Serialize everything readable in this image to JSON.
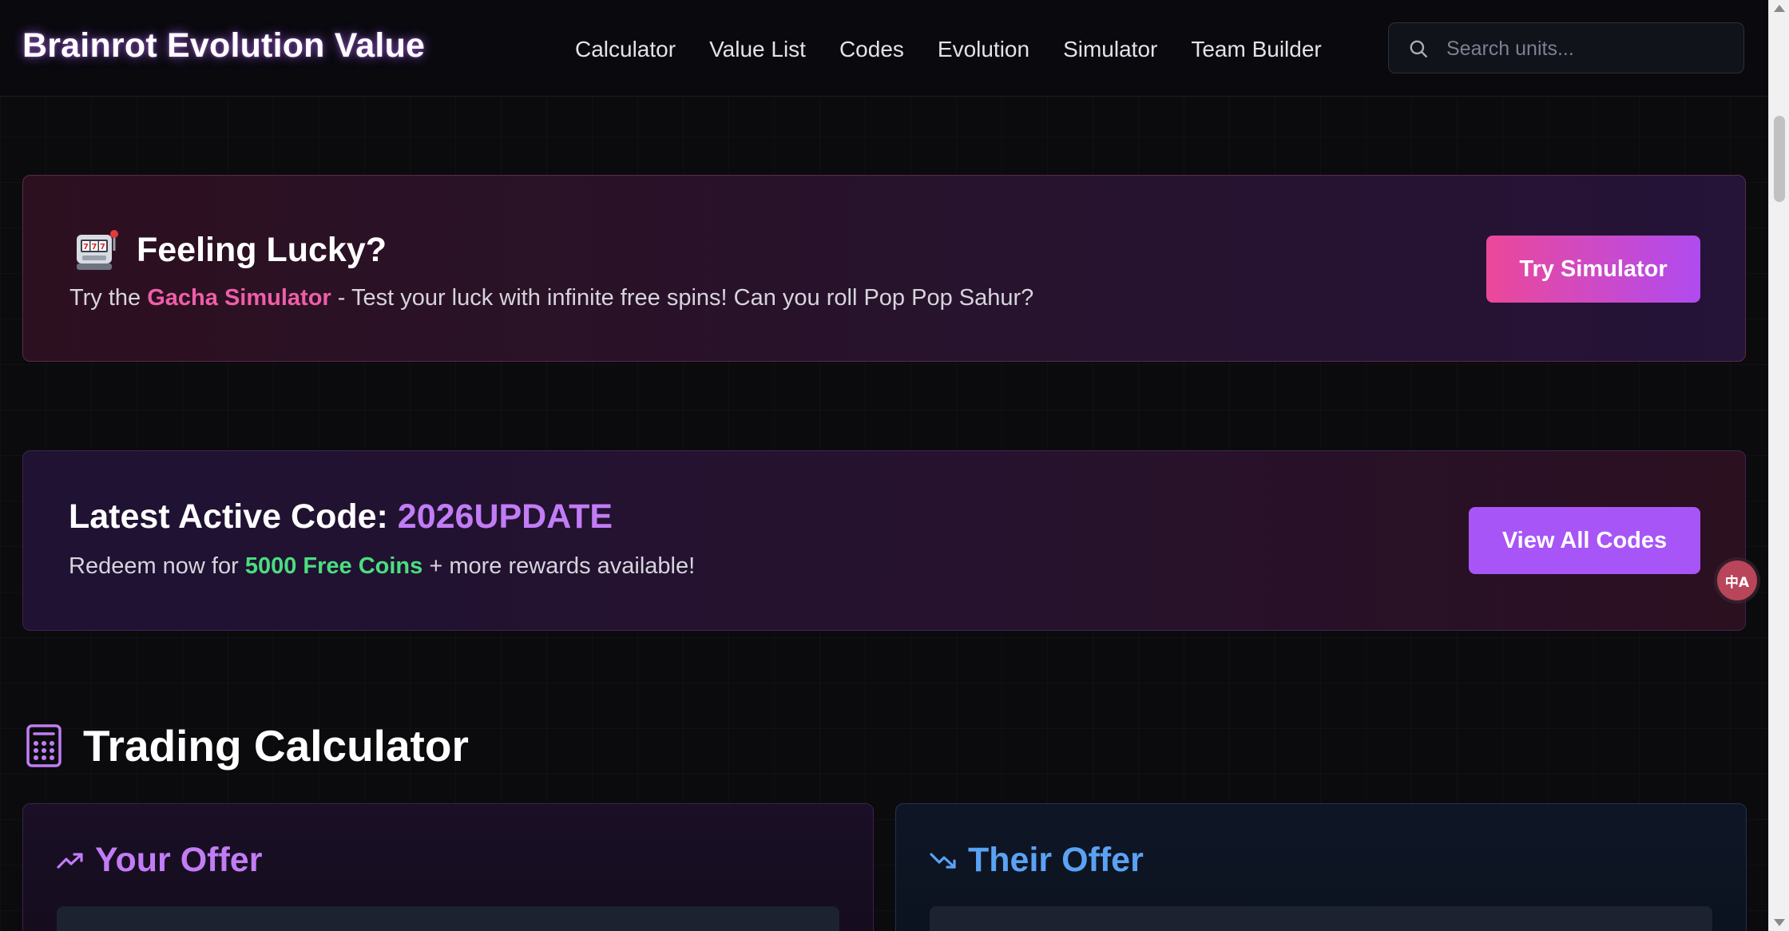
{
  "header": {
    "brand": "Brainrot Evolution Value",
    "nav": [
      {
        "label": "Calculator"
      },
      {
        "label": "Value List"
      },
      {
        "label": "Codes"
      },
      {
        "label": "Evolution"
      },
      {
        "label": "Simulator"
      },
      {
        "label": "Team Builder"
      }
    ],
    "search": {
      "placeholder": "Search units..."
    }
  },
  "lucky_card": {
    "title": "Feeling Lucky?",
    "desc_prefix": "Try the ",
    "desc_highlight": "Gacha Simulator",
    "desc_suffix": " - Test your luck with infinite free spins! Can you roll Pop Pop Sahur?",
    "button": "Try Simulator",
    "icon": "slot-machine-icon"
  },
  "code_card": {
    "title_prefix": "Latest Active Code: ",
    "code": "2026UPDATE",
    "desc_prefix": "Redeem now for ",
    "desc_highlight": "5000 Free Coins",
    "desc_suffix": " + more rewards available!",
    "button": "View All Codes"
  },
  "translate_badge": {
    "label": "中A"
  },
  "calculator": {
    "title": "Trading Calculator",
    "your_offer": {
      "title": "Your Offer",
      "icon": "trending-up-icon"
    },
    "their_offer": {
      "title": "Their Offer",
      "icon": "trending-down-icon"
    }
  },
  "colors": {
    "accent_purple": "#a855f7",
    "accent_pink": "#ec4899",
    "highlight_green": "#4ade80",
    "offer_blue": "#5aa2f4"
  }
}
